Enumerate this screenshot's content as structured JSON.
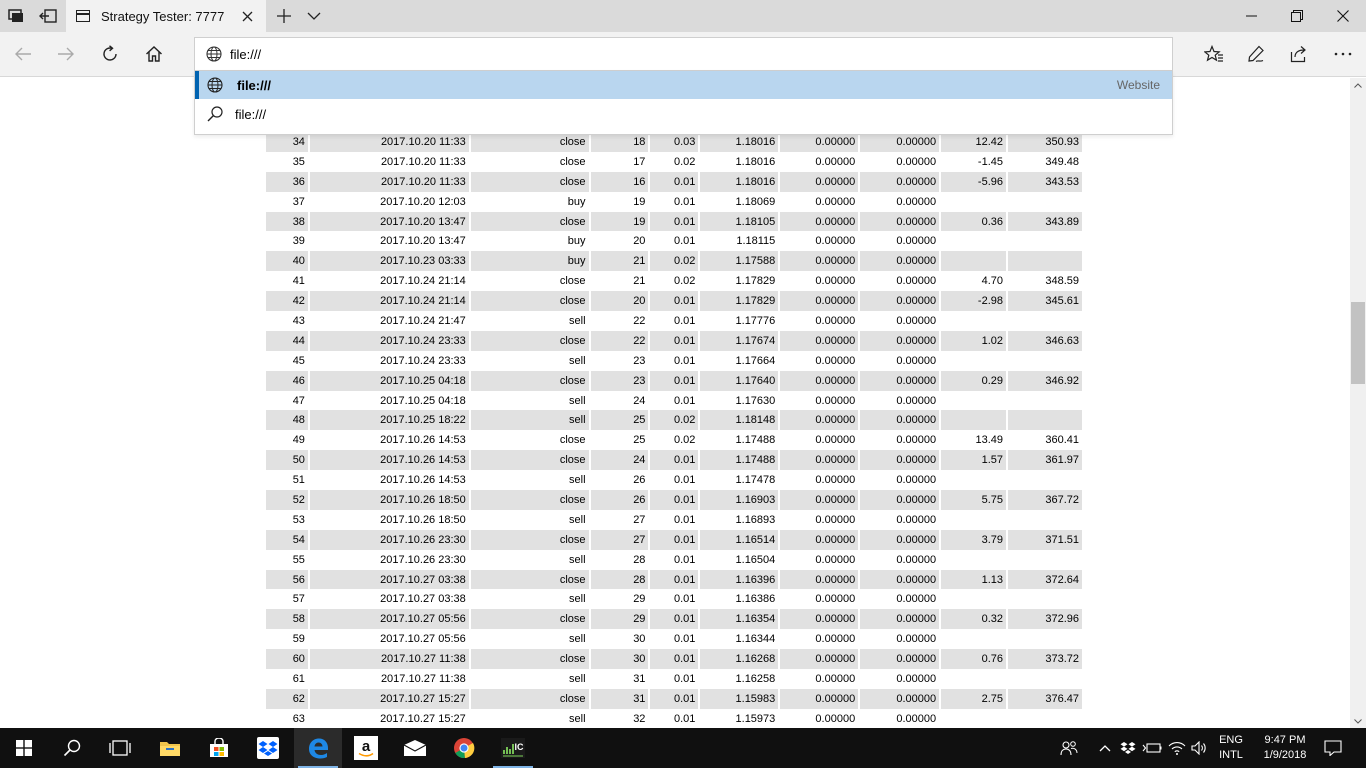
{
  "tab": {
    "title": "Strategy Tester: 7777"
  },
  "address": {
    "value": "file:///"
  },
  "suggestions": [
    {
      "text": "file:///",
      "hint": "Website"
    },
    {
      "text": "file:///",
      "hint": ""
    }
  ],
  "rows": [
    [
      "34",
      "2017.10.20 11:33",
      "close",
      "18",
      "0.03",
      "1.18016",
      "0.00000",
      "0.00000",
      "12.42",
      "350.93"
    ],
    [
      "35",
      "2017.10.20 11:33",
      "close",
      "17",
      "0.02",
      "1.18016",
      "0.00000",
      "0.00000",
      "-1.45",
      "349.48"
    ],
    [
      "36",
      "2017.10.20 11:33",
      "close",
      "16",
      "0.01",
      "1.18016",
      "0.00000",
      "0.00000",
      "-5.96",
      "343.53"
    ],
    [
      "37",
      "2017.10.20 12:03",
      "buy",
      "19",
      "0.01",
      "1.18069",
      "0.00000",
      "0.00000",
      "",
      ""
    ],
    [
      "38",
      "2017.10.20 13:47",
      "close",
      "19",
      "0.01",
      "1.18105",
      "0.00000",
      "0.00000",
      "0.36",
      "343.89"
    ],
    [
      "39",
      "2017.10.20 13:47",
      "buy",
      "20",
      "0.01",
      "1.18115",
      "0.00000",
      "0.00000",
      "",
      ""
    ],
    [
      "40",
      "2017.10.23 03:33",
      "buy",
      "21",
      "0.02",
      "1.17588",
      "0.00000",
      "0.00000",
      "",
      ""
    ],
    [
      "41",
      "2017.10.24 21:14",
      "close",
      "21",
      "0.02",
      "1.17829",
      "0.00000",
      "0.00000",
      "4.70",
      "348.59"
    ],
    [
      "42",
      "2017.10.24 21:14",
      "close",
      "20",
      "0.01",
      "1.17829",
      "0.00000",
      "0.00000",
      "-2.98",
      "345.61"
    ],
    [
      "43",
      "2017.10.24 21:47",
      "sell",
      "22",
      "0.01",
      "1.17776",
      "0.00000",
      "0.00000",
      "",
      ""
    ],
    [
      "44",
      "2017.10.24 23:33",
      "close",
      "22",
      "0.01",
      "1.17674",
      "0.00000",
      "0.00000",
      "1.02",
      "346.63"
    ],
    [
      "45",
      "2017.10.24 23:33",
      "sell",
      "23",
      "0.01",
      "1.17664",
      "0.00000",
      "0.00000",
      "",
      ""
    ],
    [
      "46",
      "2017.10.25 04:18",
      "close",
      "23",
      "0.01",
      "1.17640",
      "0.00000",
      "0.00000",
      "0.29",
      "346.92"
    ],
    [
      "47",
      "2017.10.25 04:18",
      "sell",
      "24",
      "0.01",
      "1.17630",
      "0.00000",
      "0.00000",
      "",
      ""
    ],
    [
      "48",
      "2017.10.25 18:22",
      "sell",
      "25",
      "0.02",
      "1.18148",
      "0.00000",
      "0.00000",
      "",
      ""
    ],
    [
      "49",
      "2017.10.26 14:53",
      "close",
      "25",
      "0.02",
      "1.17488",
      "0.00000",
      "0.00000",
      "13.49",
      "360.41"
    ],
    [
      "50",
      "2017.10.26 14:53",
      "close",
      "24",
      "0.01",
      "1.17488",
      "0.00000",
      "0.00000",
      "1.57",
      "361.97"
    ],
    [
      "51",
      "2017.10.26 14:53",
      "sell",
      "26",
      "0.01",
      "1.17478",
      "0.00000",
      "0.00000",
      "",
      ""
    ],
    [
      "52",
      "2017.10.26 18:50",
      "close",
      "26",
      "0.01",
      "1.16903",
      "0.00000",
      "0.00000",
      "5.75",
      "367.72"
    ],
    [
      "53",
      "2017.10.26 18:50",
      "sell",
      "27",
      "0.01",
      "1.16893",
      "0.00000",
      "0.00000",
      "",
      ""
    ],
    [
      "54",
      "2017.10.26 23:30",
      "close",
      "27",
      "0.01",
      "1.16514",
      "0.00000",
      "0.00000",
      "3.79",
      "371.51"
    ],
    [
      "55",
      "2017.10.26 23:30",
      "sell",
      "28",
      "0.01",
      "1.16504",
      "0.00000",
      "0.00000",
      "",
      ""
    ],
    [
      "56",
      "2017.10.27 03:38",
      "close",
      "28",
      "0.01",
      "1.16396",
      "0.00000",
      "0.00000",
      "1.13",
      "372.64"
    ],
    [
      "57",
      "2017.10.27 03:38",
      "sell",
      "29",
      "0.01",
      "1.16386",
      "0.00000",
      "0.00000",
      "",
      ""
    ],
    [
      "58",
      "2017.10.27 05:56",
      "close",
      "29",
      "0.01",
      "1.16354",
      "0.00000",
      "0.00000",
      "0.32",
      "372.96"
    ],
    [
      "59",
      "2017.10.27 05:56",
      "sell",
      "30",
      "0.01",
      "1.16344",
      "0.00000",
      "0.00000",
      "",
      ""
    ],
    [
      "60",
      "2017.10.27 11:38",
      "close",
      "30",
      "0.01",
      "1.16268",
      "0.00000",
      "0.00000",
      "0.76",
      "373.72"
    ],
    [
      "61",
      "2017.10.27 11:38",
      "sell",
      "31",
      "0.01",
      "1.16258",
      "0.00000",
      "0.00000",
      "",
      ""
    ],
    [
      "62",
      "2017.10.27 15:27",
      "close",
      "31",
      "0.01",
      "1.15983",
      "0.00000",
      "0.00000",
      "2.75",
      "376.47"
    ],
    [
      "63",
      "2017.10.27 15:27",
      "sell",
      "32",
      "0.01",
      "1.15973",
      "0.00000",
      "0.00000",
      "",
      ""
    ]
  ],
  "taskbar": {
    "apps": [
      "start-icon",
      "search-icon",
      "task-view-icon",
      "file-explorer-icon",
      "store-icon",
      "dropbox-icon",
      "edge-icon",
      "amazon-icon",
      "mail-icon",
      "chrome-icon",
      "trading-platform-icon"
    ],
    "active_app": "edge-icon",
    "tray": {
      "lang_top": "ENG",
      "lang_bottom": "INTL",
      "time": "9:47 PM",
      "date": "1/9/2018"
    }
  },
  "colors": {
    "accent": "#0063b1",
    "row_shade": "#e1e1e1",
    "suggest_selected": "#b9d6ef",
    "taskbar": "#101010"
  }
}
